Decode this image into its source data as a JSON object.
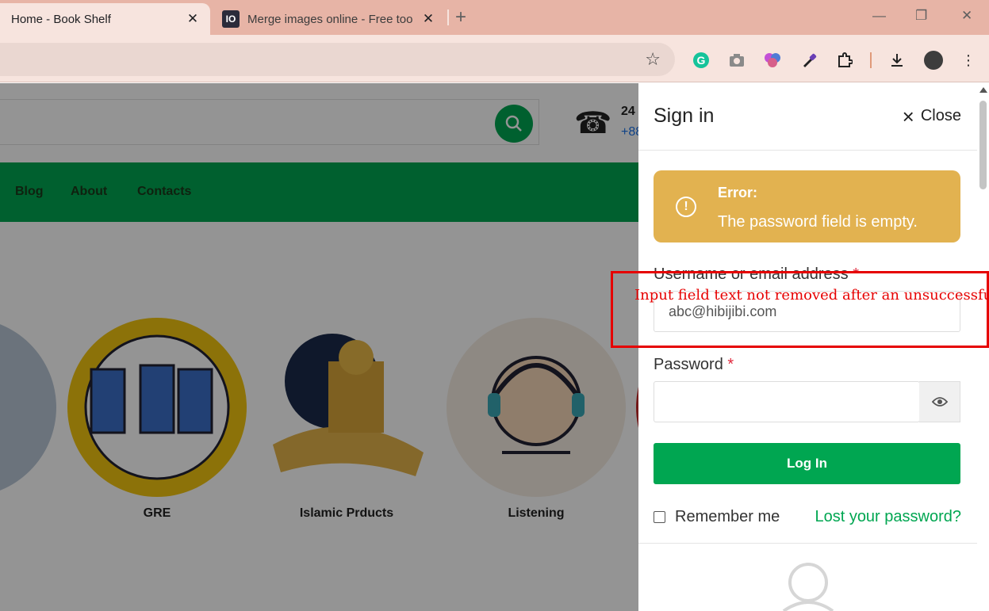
{
  "browser": {
    "tabs": [
      {
        "title": "Home - Book Shelf",
        "active": true
      },
      {
        "title": "Merge images online - Free too",
        "active": false,
        "favicon": "IO"
      }
    ],
    "new_tab_icon": "plus-icon",
    "window_controls": [
      "minimize-icon",
      "restore-icon",
      "close-icon"
    ],
    "extensions": [
      "grammarly-icon",
      "camera-icon",
      "brain-icon",
      "eyedropper-icon",
      "puzzle-icon",
      "download-icon",
      "profile-avatar",
      "more-menu-icon"
    ],
    "colors": {
      "tabbar": "#e7b4a6",
      "toolbar": "#f7e4de"
    }
  },
  "site": {
    "support_hours": "24",
    "support_phone": "+88",
    "nav": [
      "Blog",
      "About",
      "Contacts"
    ],
    "categories": [
      {
        "label": "GRE"
      },
      {
        "label": "Islamic Prducts"
      },
      {
        "label": "Listening"
      }
    ],
    "accent": "#00a651"
  },
  "signin": {
    "title": "Sign in",
    "close_label": "Close",
    "error": {
      "title": "Error:",
      "message": "The password field is empty.",
      "color": "#e2b250"
    },
    "username": {
      "label": "Username or email address",
      "required_mark": "*",
      "value": "abc@hibijibi.com"
    },
    "password": {
      "label": "Password",
      "required_mark": "*",
      "value": ""
    },
    "login_label": "Log In",
    "remember_label": "Remember me",
    "lost_password_label": "Lost your password?"
  },
  "annotation": {
    "text": "Input field text not removed after an unsuccessful em",
    "color": "#e60000"
  }
}
